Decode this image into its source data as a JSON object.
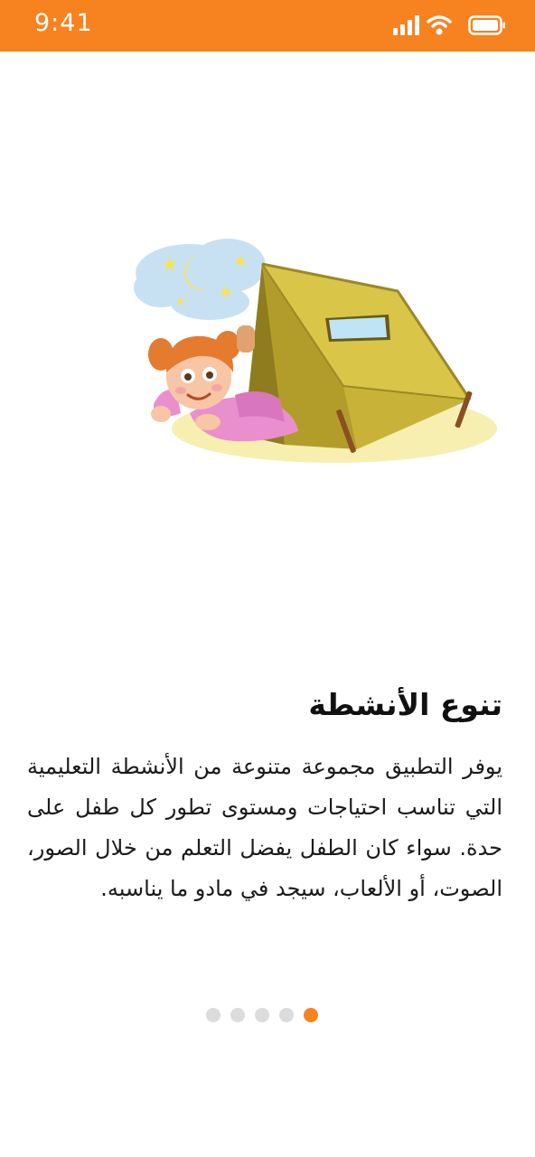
{
  "status_bar": {
    "time": "9:41",
    "background": "#f78220",
    "icons": [
      "signal-icon",
      "wifi-icon",
      "battery-icon"
    ]
  },
  "illustration": {
    "icon": "girl-in-tent-illustration"
  },
  "onboarding": {
    "title": "تنوع الأنشطة",
    "description": "يوفر التطبيق مجموعة متنوعة من الأنشطة التعليمية التي تناسب احتياجات ومستوى تطور كل طفل على حدة. سواء كان الطفل يفضل التعلم من خلال الصور، الصوت، أو الألعاب، سيجد في مادو ما يناسبه."
  },
  "pagination": {
    "total": 5,
    "active_index": 4,
    "active_color": "#f78220",
    "inactive_color": "#dcdcdc"
  }
}
